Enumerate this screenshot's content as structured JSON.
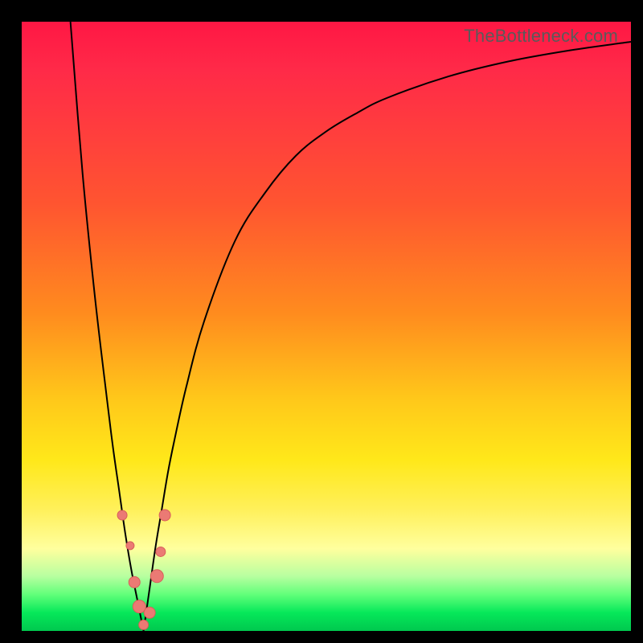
{
  "watermark": "TheBottleneck.com",
  "colors": {
    "top": "#ff1744",
    "mid_upper": "#ff8c1e",
    "mid_lower": "#ffe81a",
    "bottom": "#00c84e",
    "curve": "#000000",
    "marker_fill": "#eb7a74",
    "marker_stroke": "#d85f59",
    "frame": "#000000"
  },
  "chart_data": {
    "type": "line",
    "title": "",
    "xlabel": "",
    "ylabel": "",
    "xlim": [
      0,
      100
    ],
    "ylim": [
      0,
      100
    ],
    "curve_left": {
      "name": "left-branch",
      "x": [
        8,
        10,
        12,
        14,
        15,
        16,
        17,
        18,
        19,
        20
      ],
      "y": [
        100,
        75,
        55,
        38,
        30,
        23,
        16,
        10,
        5,
        0
      ]
    },
    "curve_right": {
      "name": "right-branch",
      "x": [
        20,
        21,
        22,
        23,
        24,
        25,
        27,
        30,
        35,
        40,
        45,
        50,
        55,
        60,
        70,
        80,
        90,
        100
      ],
      "y": [
        0,
        7,
        14,
        20,
        26,
        31,
        40,
        51,
        64,
        72,
        78,
        82,
        85,
        87.5,
        91,
        93.5,
        95.3,
        96.7
      ]
    },
    "markers": [
      {
        "x": 16.5,
        "y": 19,
        "r": 6
      },
      {
        "x": 17.8,
        "y": 14,
        "r": 5
      },
      {
        "x": 18.5,
        "y": 8,
        "r": 7
      },
      {
        "x": 19.3,
        "y": 4,
        "r": 8
      },
      {
        "x": 20.0,
        "y": 1,
        "r": 6
      },
      {
        "x": 21.0,
        "y": 3,
        "r": 7
      },
      {
        "x": 22.2,
        "y": 9,
        "r": 8
      },
      {
        "x": 22.8,
        "y": 13,
        "r": 6
      },
      {
        "x": 23.5,
        "y": 19,
        "r": 7
      }
    ]
  }
}
